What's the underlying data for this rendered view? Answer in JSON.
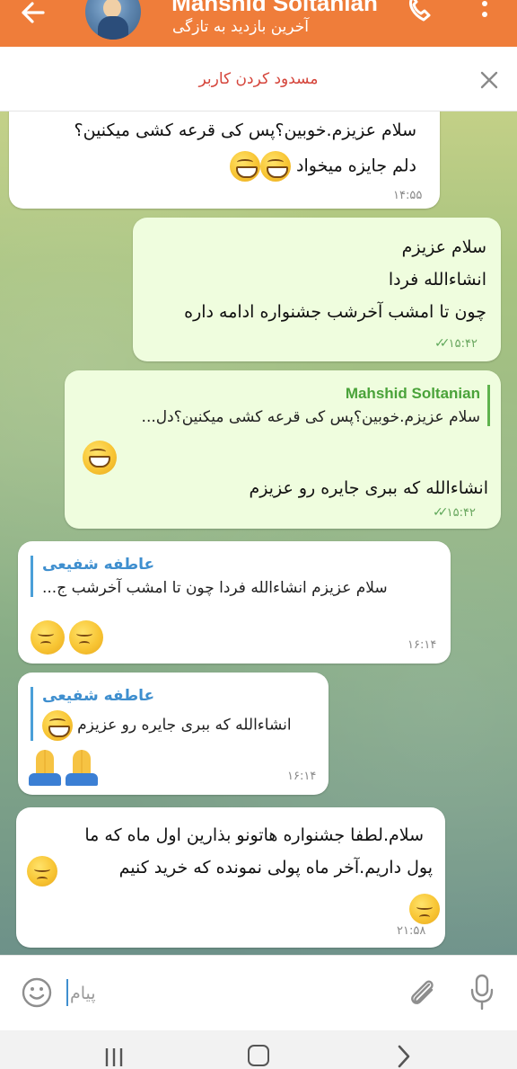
{
  "header": {
    "title": "Mahshid Soltanian",
    "status": "آخرین بازدید به تازگی",
    "accent_color": "#ef7d3a",
    "back_icon": "arrow-left-icon",
    "call_icon": "phone-icon",
    "menu_icon": "more-vertical-icon"
  },
  "block_bar": {
    "label": "مسدود کردن کاربر",
    "close_icon": "close-icon"
  },
  "messages": [
    {
      "direction": "incoming",
      "lines": [
        "سلام عزیزم.خوبین؟پس کی قرعه کشی میکنین؟",
        "دلم جایزه میخواد"
      ],
      "emojis": [
        "grinning-face",
        "grinning-face"
      ],
      "time": "۱۴:۵۵"
    },
    {
      "direction": "outgoing",
      "lines": [
        "سلام عزیزم",
        "انشاءالله فردا",
        "چون تا امشب آخرشب جشنواره ادامه داره"
      ],
      "time": "۱۵:۴۲",
      "read": true
    },
    {
      "direction": "outgoing",
      "reply": {
        "name": "Mahshid Soltanian",
        "text": "سلام عزیزم.خوبین؟پس کی قرعه کشی میکنین؟دل..."
      },
      "reply_emoji": "grinning-face",
      "lines": [
        "انشاءالله که ببری جایره رو عزیزم"
      ],
      "time": "۱۵:۴۲",
      "read": true
    },
    {
      "direction": "incoming",
      "reply": {
        "name": "عاطفه شفیعی",
        "text": "سلام عزیزم انشاءالله فردا  چون تا امشب آخرشب ج..."
      },
      "emojis": [
        "pensive-face",
        "pensive-face"
      ],
      "time": "۱۶:۱۴"
    },
    {
      "direction": "incoming",
      "reply": {
        "name": "عاطفه شفیعی",
        "text": "انشاءالله که ببری جایره رو عزیزم"
      },
      "emojis": [
        "folded-hands",
        "folded-hands"
      ],
      "time": "۱۶:۱۴"
    },
    {
      "direction": "incoming",
      "lines": [
        "سلام.لطفا جشنواره هاتونو بذارین اول ماه که ما",
        "پول داریم.آخر ماه پولی نمونده که خرید کنیم"
      ],
      "emojis": [
        "pensive-face"
      ],
      "time": "۲۱:۵۸"
    }
  ],
  "composer": {
    "placeholder": "پیام",
    "emoji_icon": "smiley-icon",
    "attach_icon": "paperclip-icon",
    "mic_icon": "microphone-icon"
  },
  "nav": {
    "recent_icon": "recent-apps-icon",
    "home_icon": "home-icon",
    "back_icon": "chevron-right-icon"
  }
}
